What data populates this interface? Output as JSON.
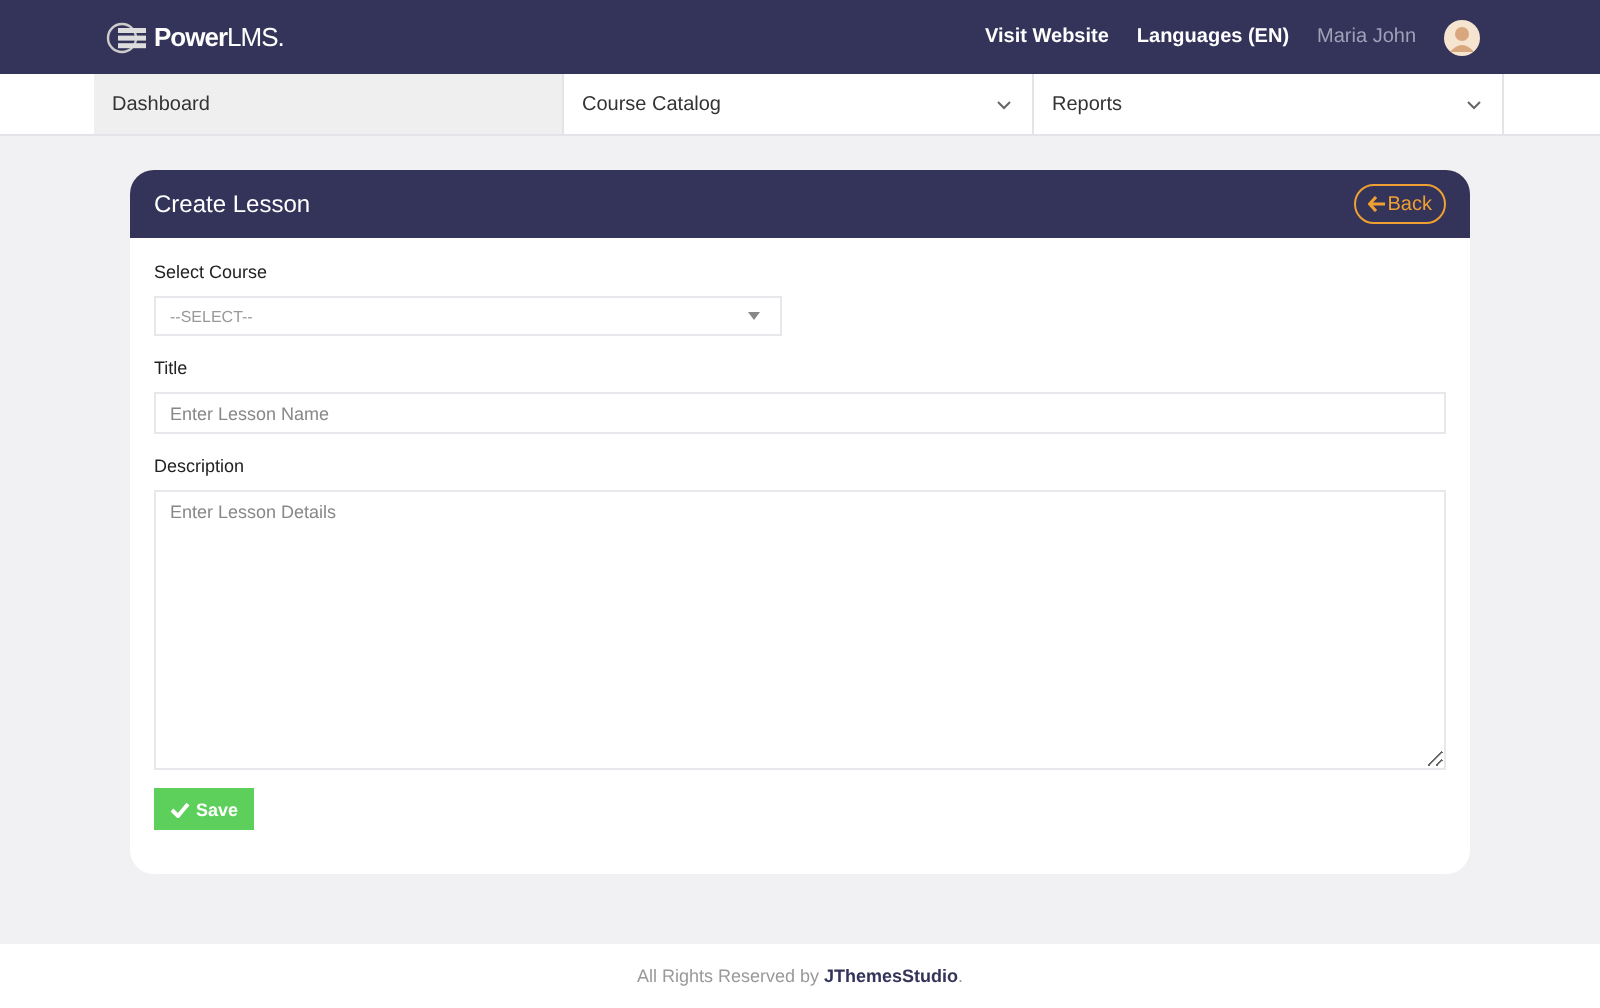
{
  "header": {
    "logo": "**Power**LMS.",
    "links": [
      "Visit Website",
      "Languages (EN)"
    ],
    "user_name": "Maria John"
  },
  "nav": [
    {
      "label": "Dashboard",
      "selected": true,
      "dropdown": false
    },
    {
      "label": "Course Catalog",
      "selected": false,
      "dropdown": true
    },
    {
      "label": "Reports",
      "selected": false,
      "dropdown": true
    }
  ],
  "card": {
    "title": "Create Lesson",
    "back_button": "Back",
    "fields": [
      {
        "kind": "select",
        "label": "Select Course",
        "placeholder": "--SELECT--"
      },
      {
        "kind": "text",
        "label": "Title",
        "placeholder": "Enter Lesson Name"
      },
      {
        "kind": "textarea",
        "label": "Description",
        "placeholder": "Enter Lesson Details"
      }
    ],
    "save_button": "Save"
  },
  "footer": {
    "text": "All Rights Reserved by",
    "link": "JThemesStudio",
    "suffix": "."
  }
}
